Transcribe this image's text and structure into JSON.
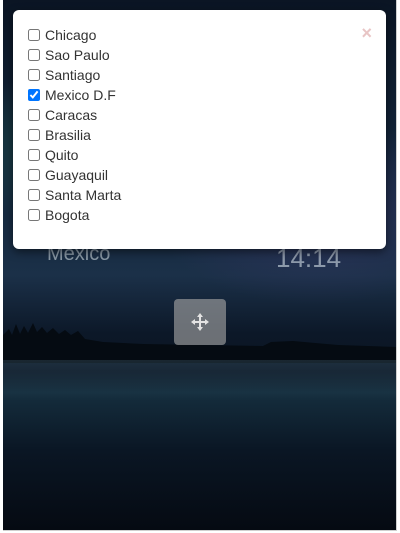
{
  "modal": {
    "close_label": "×",
    "cities": [
      {
        "label": "Chicago",
        "checked": false
      },
      {
        "label": "Sao Paulo",
        "checked": false
      },
      {
        "label": "Santiago",
        "checked": false
      },
      {
        "label": "Mexico D.F",
        "checked": true
      },
      {
        "label": "Caracas",
        "checked": false
      },
      {
        "label": "Brasilia",
        "checked": false
      },
      {
        "label": "Quito",
        "checked": false
      },
      {
        "label": "Guayaquil",
        "checked": false
      },
      {
        "label": "Santa Marta",
        "checked": false
      },
      {
        "label": "Bogota",
        "checked": false
      }
    ]
  },
  "widget": {
    "city": "Mexico",
    "time": "14:14",
    "move_icon": "move-arrows-icon"
  }
}
